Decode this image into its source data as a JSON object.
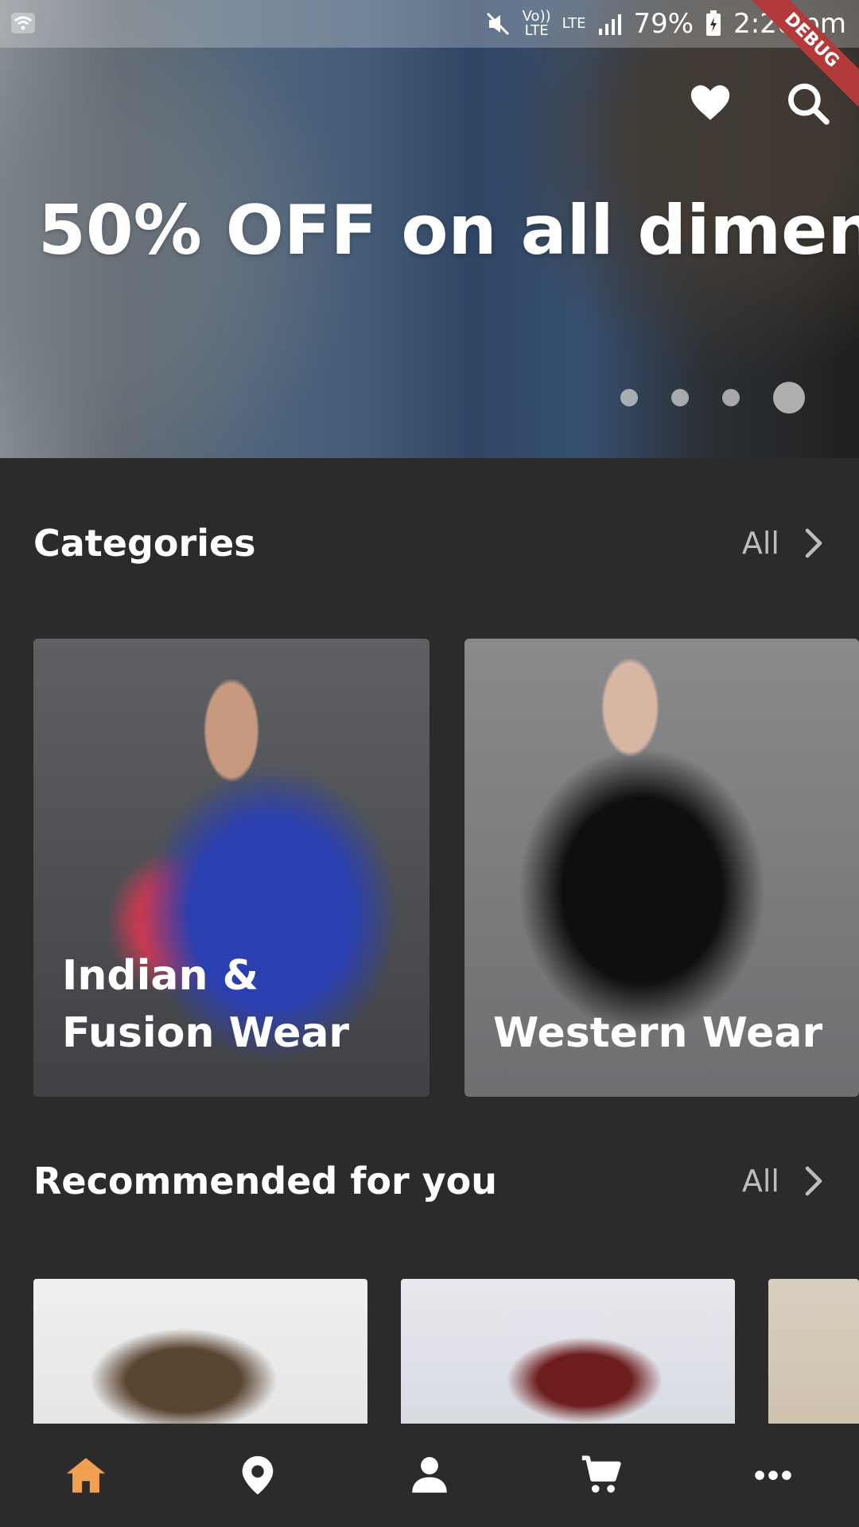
{
  "status_bar": {
    "network_top": "Vo))",
    "network_bottom": "LTE",
    "lte": "LTE",
    "battery": "79%",
    "time": "2:20 pm",
    "debug_banner": "DEBUG"
  },
  "hero": {
    "title": "50% OFF on all dimen",
    "carousel": {
      "count": 4,
      "active_index": 3
    }
  },
  "categories": {
    "title": "Categories",
    "all_label": "All",
    "items": [
      {
        "label": "Indian & Fusion Wear"
      },
      {
        "label": "Western Wear"
      }
    ]
  },
  "recommended": {
    "title": "Recommended for you",
    "all_label": "All"
  },
  "bottom_nav": {
    "active": "home",
    "accent": "#f0a050",
    "items": [
      "home-icon",
      "location-icon",
      "profile-icon",
      "cart-icon",
      "more-icon"
    ]
  }
}
